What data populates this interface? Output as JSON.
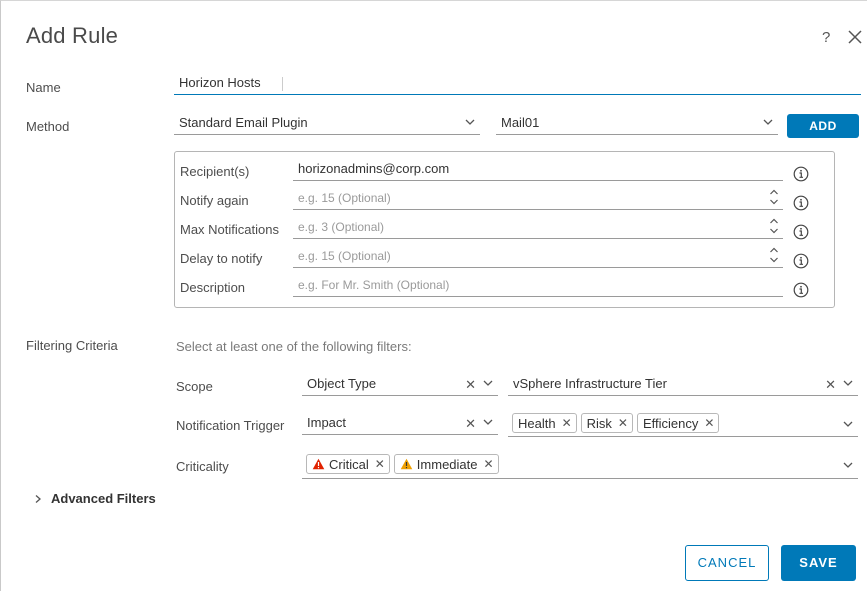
{
  "dialog": {
    "title": "Add Rule",
    "help_icon": "?",
    "close_icon": "close-icon"
  },
  "name_field": {
    "label": "Name",
    "value": "Horizon Hosts"
  },
  "method": {
    "label": "Method",
    "plugin_value": "Standard Email Plugin",
    "instance_value": "Mail01",
    "add_label": "ADD"
  },
  "config": {
    "recipients_label": "Recipient(s)",
    "recipients_value": "horizonadmins@corp.com",
    "notify_again_label": "Notify again",
    "notify_again_placeholder": "e.g. 15 (Optional)",
    "max_notifications_label": "Max Notifications",
    "max_notifications_placeholder": "e.g. 3 (Optional)",
    "delay_label": "Delay to notify",
    "delay_placeholder": "e.g. 15 (Optional)",
    "description_label": "Description",
    "description_placeholder": "e.g. For Mr. Smith (Optional)"
  },
  "filtering": {
    "label": "Filtering Criteria",
    "hint": "Select at least one of the following filters:",
    "scope_label": "Scope",
    "scope_type": "Object Type",
    "scope_value": "vSphere Infrastructure Tier",
    "trigger_label": "Notification Trigger",
    "trigger_type": "Impact",
    "trigger_tags": [
      "Health",
      "Risk",
      "Efficiency"
    ],
    "criticality_label": "Criticality",
    "criticality_tags": [
      "Critical",
      "Immediate"
    ],
    "critical_color": "#e12200",
    "immediate_color": "#f0a000"
  },
  "advanced": {
    "label": "Advanced Filters"
  },
  "footer": {
    "cancel_label": "CANCEL",
    "save_label": "SAVE"
  },
  "colors": {
    "accent": "#0079b8"
  }
}
